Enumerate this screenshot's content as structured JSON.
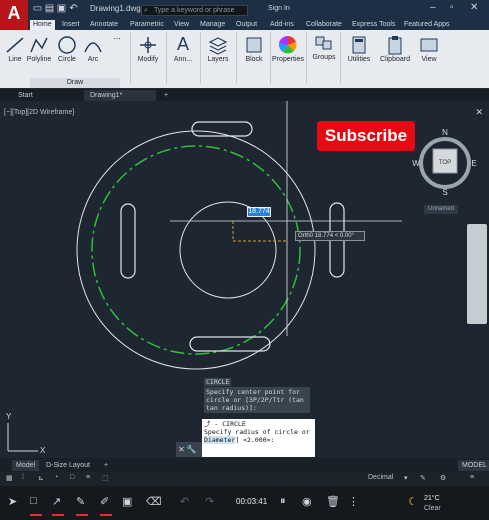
{
  "titlebar": {
    "app_logo": "A",
    "document_title": "Drawing1.dwg",
    "search_placeholder": "Type a keyword or phrase",
    "signin": "Sign In"
  },
  "ribbon_tabs": [
    "Home",
    "Insert",
    "Annotate",
    "Parametric",
    "View",
    "Manage",
    "Output",
    "Add-ins",
    "Collaborate",
    "Express Tools",
    "Featured Apps"
  ],
  "ribbon_tools": {
    "line": "Line",
    "polyline": "Polyline",
    "circle": "Circle",
    "arc": "Arc",
    "draw_panel": "Draw",
    "modify": "Modify",
    "annotation": "Ann...",
    "layers": "Layers",
    "block": "Block",
    "properties": "Properties",
    "groups": "Groups",
    "utilities": "Utilities",
    "clipboard": "Clipboard",
    "view": "View"
  },
  "file_tabs": {
    "start": "Start",
    "drawing": "Drawing1*",
    "new_tab": "+"
  },
  "viewport": {
    "label": "[−][Top][2D Wireframe]",
    "subscribe": "Subscribe",
    "viewcube_top": "TOP",
    "compass": {
      "n": "N",
      "s": "S",
      "e": "E",
      "w": "W"
    },
    "unnamed": "Unnamed",
    "dynamic_input": "18.774",
    "ortho_tip": "Orth0 18.774 < 0.00°",
    "ucs_y": "Y",
    "ucs_x": "X"
  },
  "command": {
    "history_head": "CIRCLE",
    "history_body": "Specify center point for circle or [3P/2P/Ttr (tan tan radius)]:",
    "current_cmd": "CIRCLE",
    "prompt": "Specify radius of circle or",
    "option": "Diameter",
    "default": "] <2.000>:"
  },
  "layout_tabs": [
    "Model",
    "D-Size Layout"
  ],
  "status": {
    "model": "MODEL",
    "decimal": "Decimal"
  },
  "recorder": {
    "timer": "00:03:41",
    "temp": "21°C",
    "condition": "Clear"
  },
  "colors": {
    "accent_red": "#b8151b",
    "subscribe_red": "#e50914",
    "circle_green": "#2fbf3c",
    "dyn_blue": "#2a7fd1"
  }
}
